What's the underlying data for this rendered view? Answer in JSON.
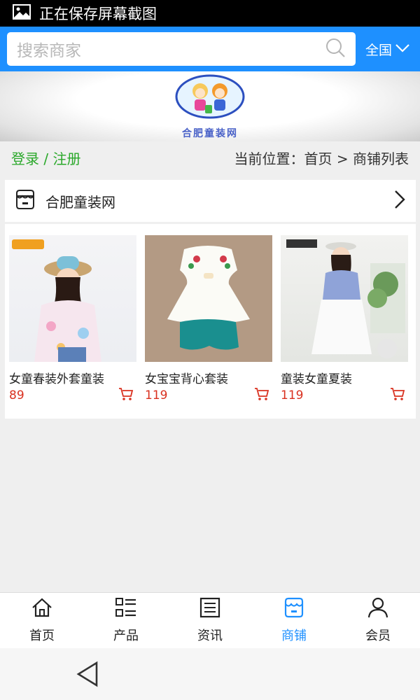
{
  "status_bar": {
    "text": "正在保存屏幕截图"
  },
  "search": {
    "placeholder": "搜索商家",
    "region": "全国"
  },
  "banner": {
    "logo_text": "合肥童装网"
  },
  "crumb": {
    "login_register": "登录 / 注册",
    "location": "当前位置：首页 > 商铺列表"
  },
  "shop": {
    "name": "合肥童装网"
  },
  "products": [
    {
      "name": "女童春装外套童装",
      "price": "89"
    },
    {
      "name": "女宝宝背心套装",
      "price": "119"
    },
    {
      "name": "童装女童夏装",
      "price": "119"
    }
  ],
  "nav": [
    {
      "label": "首页",
      "icon": "home-icon"
    },
    {
      "label": "产品",
      "icon": "grid-list-icon"
    },
    {
      "label": "资讯",
      "icon": "news-icon"
    },
    {
      "label": "商铺",
      "icon": "shop-icon"
    },
    {
      "label": "会员",
      "icon": "user-icon"
    }
  ],
  "colors": {
    "primary": "#1e90ff",
    "price": "#d9301f",
    "login": "#2aa82a"
  }
}
